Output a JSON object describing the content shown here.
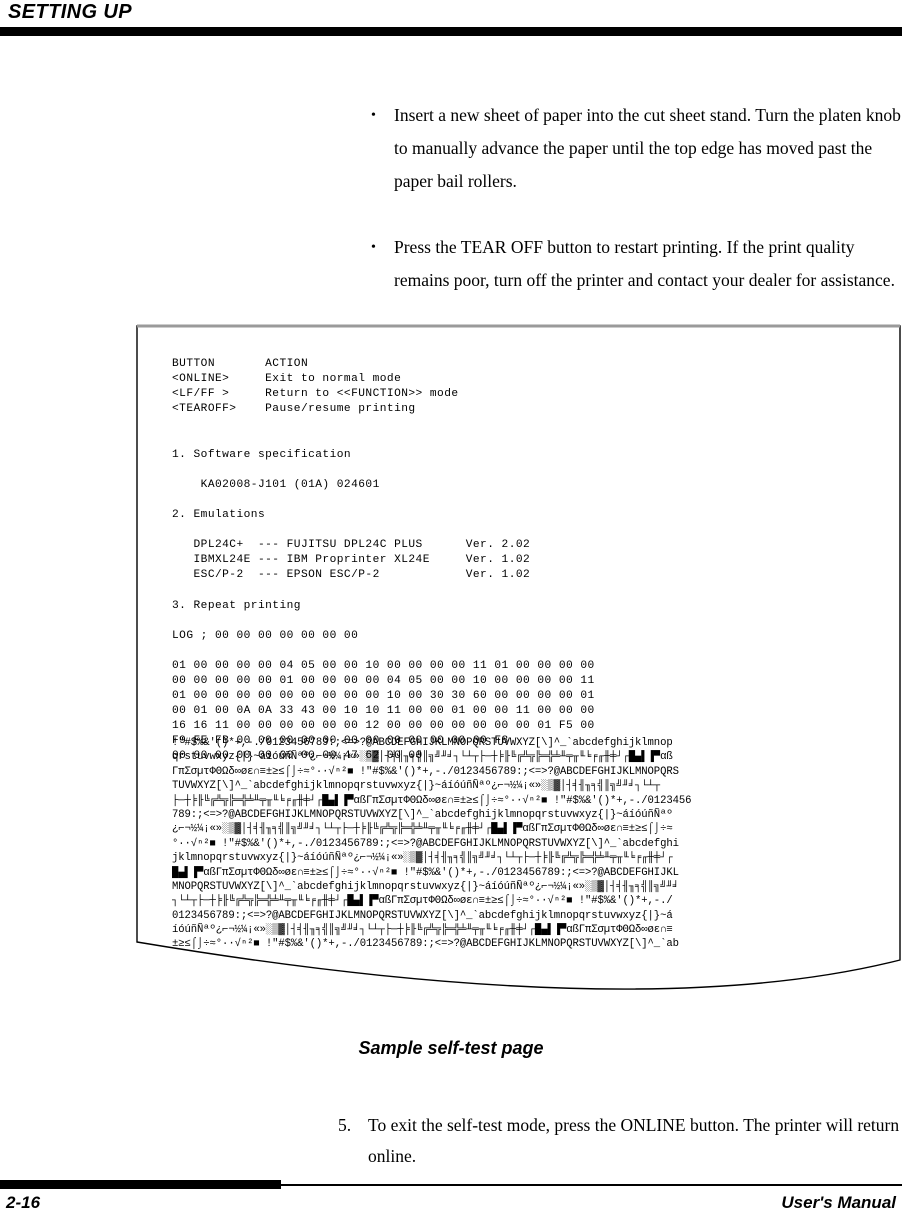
{
  "header": {
    "section_title": "SETTING UP"
  },
  "intro_bullets": [
    {
      "marker": "•",
      "text": "Insert a new sheet of paper into the cut sheet stand.  Turn the platen knob to manually advance the paper until the top edge has moved past the paper bail rollers."
    },
    {
      "marker": "•",
      "text": "Press the TEAR OFF button to restart printing.  If the print quality remains poor, turn off the printer and contact your dealer for assistance."
    }
  ],
  "selftest_printout": {
    "lines": [
      "BUTTON       ACTION",
      "<ONLINE>     Exit to normal mode",
      "<LF/FF >     Return to <<FUNCTION>> mode",
      "<TEAROFF>    Pause/resume printing",
      "",
      "",
      "1. Software specification",
      "",
      "    KA02008-J101 (01A) 024601",
      "",
      "2. Emulations",
      "",
      "   DPL24C+  --- FUJITSU DPL24C PLUS      Ver. 2.02",
      "   IBMXL24E --- IBM Proprinter XL24E     Ver. 1.02",
      "   ESC/P-2  --- EPSON ESC/P-2            Ver. 1.02",
      "",
      "3. Repeat printing",
      "",
      "LOG ; 00 00 00 00 00 00 00",
      "",
      "01 00 00 00 00 04 05 00 00 10 00 00 00 00 11 01 00 00 00 00",
      "00 00 00 00 00 01 00 00 00 00 04 05 00 00 10 00 00 00 00 11",
      "01 00 00 00 00 00 00 00 00 00 10 00 30 30 60 00 00 00 00 01",
      "00 01 00 0A 0A 33 43 00 10 10 11 00 00 01 00 00 11 00 00 00",
      "16 16 11 00 00 00 00 00 00 12 00 00 00 00 00 00 00 01 F5 00",
      "F9 FE FB 00 00 00 00 00 00 00 00 00 00 00 00 F8",
      "00 00 00 00 00 00 00 00 47 62 00 00"
    ]
  },
  "character_pattern": {
    "description": "rolling IBM PC codepage 437 character set test pattern",
    "lines": [
      "!\"#$%&'()*+,-./0123456789:;<=>?@ABCDEFGHIJKLMNOPQRSTUVWXYZ[\\]^_`abcdefghijklmnop",
      "qrstuvwxyz{|}~áíóúñÑªº¿⌐¬½¼¡«»░▒▓│┤╡╢╖╕╣║╗╝╜╛┐└┴┬├─┼╞╟╚╔╩╦╠═╬╧╨╤╥╙╘╒╓╫╪┘┌█▄▌▐▀αß",
      "ΓπΣσµτΦΘΩδ∞øε∩≡±≥≤⌠⌡÷≈°∙·√ⁿ²■ !\"#$%&'()*+,-./0123456789:;<=>?@ABCDEFGHIJKLMNOPQRS",
      "TUVWXYZ[\\]^_`abcdefghijklmnopqrstuvwxyz{|}~áíóúñÑªº¿⌐¬½¼¡«»░▒▓│┤╡╢╖╕╣║╗╝╜╛┐└┴┬",
      "├─┼╞╟╚╔╩╦╠═╬╧╨╤╥╙╘╒╓╫╪┘┌█▄▌▐▀αßΓπΣσµτΦΘΩδ∞øε∩≡±≥≤⌠⌡÷≈°∙·√ⁿ²■ !\"#$%&'()*+,-./0123456",
      "789:;<=>?@ABCDEFGHIJKLMNOPQRSTUVWXYZ[\\]^_`abcdefghijklmnopqrstuvwxyz{|}~áíóúñÑªº",
      "¿⌐¬½¼¡«»░▒▓│┤╡╢╖╕╣║╗╝╜╛┐└┴┬├─┼╞╟╚╔╩╦╠═╬╧╨╤╥╙╘╒╓╫╪┘┌█▄▌▐▀αßΓπΣσµτΦΘΩδ∞øε∩≡±≥≤⌠⌡÷≈",
      "°∙·√ⁿ²■ !\"#$%&'()*+,-./0123456789:;<=>?@ABCDEFGHIJKLMNOPQRSTUVWXYZ[\\]^_`abcdefghi",
      "jklmnopqrstuvwxyz{|}~áíóúñÑªº¿⌐¬½¼¡«»░▒▓│┤╡╢╖╕╣║╗╝╜╛┐└┴┬├─┼╞╟╚╔╩╦╠═╬╧╨╤╥╙╘╒╓╫╪┘┌",
      "█▄▌▐▀αßΓπΣσµτΦΘΩδ∞øε∩≡±≥≤⌠⌡÷≈°∙·√ⁿ²■ !\"#$%&'()*+,-./0123456789:;<=>?@ABCDEFGHIJKL",
      "MNOPQRSTUVWXYZ[\\]^_`abcdefghijklmnopqrstuvwxyz{|}~áíóúñÑªº¿⌐¬½¼¡«»░▒▓│┤╡╢╖╕╣║╗╝╜╛",
      "┐└┴┬├─┼╞╟╚╔╩╦╠═╬╧╨╤╥╙╘╒╓╫╪┘┌█▄▌▐▀αßΓπΣσµτΦΘΩδ∞øε∩≡±≥≤⌠⌡÷≈°∙·√ⁿ²■ !\"#$%&'()*+,-./",
      "0123456789:;<=>?@ABCDEFGHIJKLMNOPQRSTUVWXYZ[\\]^_`abcdefghijklmnopqrstuvwxyz{|}~á",
      "íóúñÑªº¿⌐¬½¼¡«»░▒▓│┤╡╢╖╕╣║╗╝╜╛┐└┴┬├─┼╞╟╚╔╩╦╠═╬╧╨╤╥╙╘╒╓╫╪┘┌█▄▌▐▀αßΓπΣσµτΦΘΩδ∞øε∩≡",
      "±≥≤⌠⌡÷≈°∙·√ⁿ²■ !\"#$%&'()*+,-./0123456789:;<=>?@ABCDEFGHIJKLMNOPQRSTUVWXYZ[\\]^_`ab"
    ]
  },
  "figure_caption": "Sample self-test page",
  "closing_step": {
    "number": "5.",
    "text": "To exit the self-test mode, press the ONLINE button.  The printer will return online."
  },
  "footer": {
    "page_number": "2-16",
    "manual_label": "User's Manual"
  }
}
